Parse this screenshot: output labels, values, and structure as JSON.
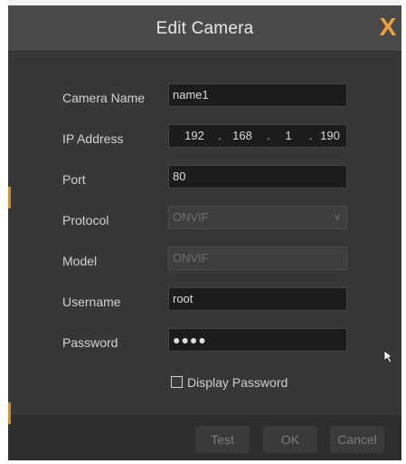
{
  "dialog": {
    "title": "Edit Camera",
    "close_glyph": "X"
  },
  "form": {
    "camera_name": {
      "label": "Camera Name",
      "value": "name1"
    },
    "ip_address": {
      "label": "IP Address",
      "octets": [
        "192",
        "168",
        "1",
        "190"
      ],
      "separator": "."
    },
    "port": {
      "label": "Port",
      "value": "80"
    },
    "protocol": {
      "label": "Protocol",
      "value": "ONVIF"
    },
    "model": {
      "label": "Model",
      "value": "ONVIF"
    },
    "username": {
      "label": "Username",
      "value": "root"
    },
    "password": {
      "label": "Password",
      "value": "●●●●"
    }
  },
  "display_password": {
    "label": "Display Password",
    "checked": false
  },
  "buttons": {
    "test": "Test",
    "ok": "OK",
    "cancel": "Cancel"
  },
  "icons": {
    "close": "close-icon",
    "dropdown": "chevron-down-icon",
    "cursor": "mouse-pointer-icon"
  },
  "colors": {
    "accent": "#f0a13a",
    "background": "#373737"
  }
}
